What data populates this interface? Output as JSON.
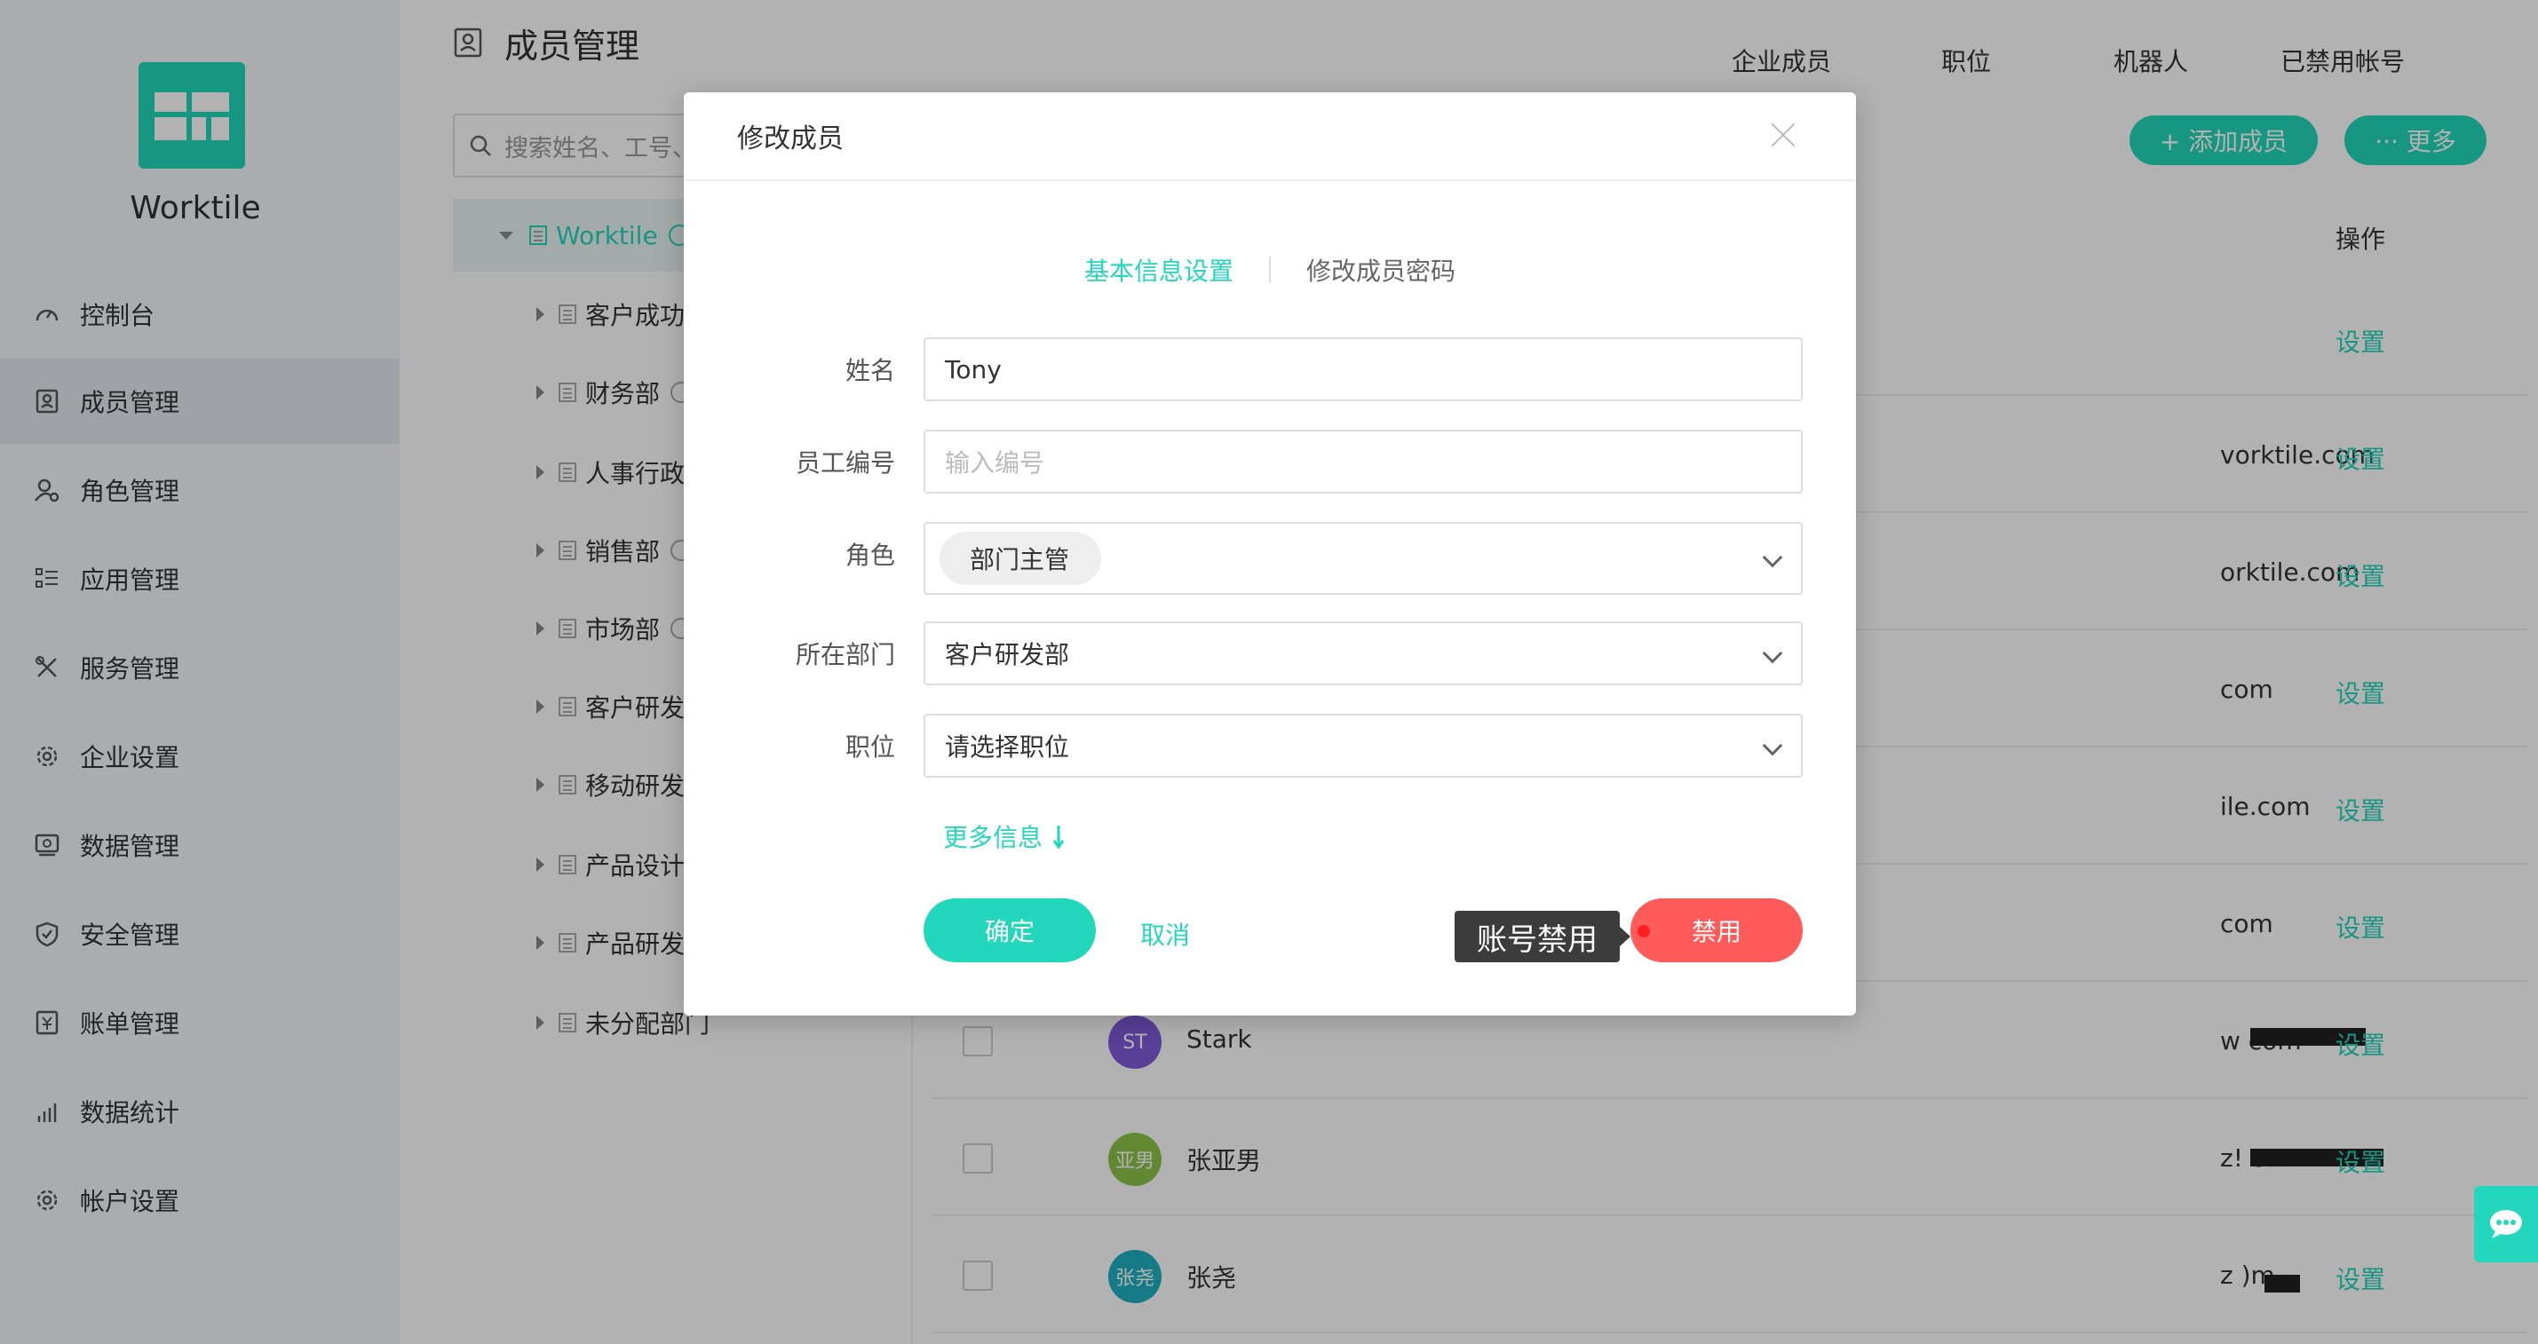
{
  "app": {
    "name": "Worktile",
    "brand_color": "#22d7bb"
  },
  "sidebar": {
    "items": [
      {
        "label": "控制台",
        "icon": "dashboard-icon"
      },
      {
        "label": "成员管理",
        "icon": "members-icon",
        "active": true
      },
      {
        "label": "角色管理",
        "icon": "roles-icon"
      },
      {
        "label": "应用管理",
        "icon": "apps-icon"
      },
      {
        "label": "服务管理",
        "icon": "tools-icon"
      },
      {
        "label": "企业设置",
        "icon": "gear-icon"
      },
      {
        "label": "数据管理",
        "icon": "data-icon"
      },
      {
        "label": "安全管理",
        "icon": "shield-icon"
      },
      {
        "label": "账单管理",
        "icon": "bill-icon"
      },
      {
        "label": "数据统计",
        "icon": "chart-icon"
      },
      {
        "label": "帐户设置",
        "icon": "settings-icon"
      }
    ]
  },
  "header": {
    "title": "成员管理",
    "tabs": [
      "企业成员",
      "职位",
      "机器人",
      "已禁用帐号"
    ]
  },
  "search": {
    "placeholder": "搜索姓名、工号、"
  },
  "toolbar": {
    "add_label": "+ 添加成员",
    "more_label": "··· 更多"
  },
  "tree": {
    "root": "Worktile",
    "children": [
      "客户成功",
      "财务部",
      "人事行政",
      "销售部",
      "市场部",
      "客户研发",
      "移动研发",
      "产品设计",
      "产品研发",
      "未分配部门"
    ]
  },
  "table": {
    "op_header": "操作",
    "rows": [
      {
        "email": "",
        "action": "设置"
      },
      {
        "email": "vorktile.com",
        "action": "设置"
      },
      {
        "email": "orktile.com",
        "action": "设置"
      },
      {
        "email": "com",
        "action": "设置"
      },
      {
        "email": "ile.com",
        "action": "设置"
      },
      {
        "email": "com",
        "action": "设置"
      },
      {
        "initials": "ST",
        "name": "Stark",
        "avatar_color": "#7e5bd8",
        "email": "w               com",
        "action": "设置"
      },
      {
        "initials": "亚男",
        "name": "张亚男",
        "avatar_color": "#8bc34a",
        "email": "z!                om",
        "action": "设置"
      },
      {
        "initials": "张尧",
        "name": "张尧",
        "avatar_color": "#1fb0c0",
        "email": "z                  )m",
        "action": "设置"
      }
    ]
  },
  "modal": {
    "title": "修改成员",
    "tabs": [
      "基本信息设置",
      "修改成员密码"
    ],
    "active_tab": 0,
    "fields": {
      "name": {
        "label": "姓名",
        "value": "Tony"
      },
      "employee_id": {
        "label": "员工编号",
        "placeholder": "输入编号"
      },
      "role": {
        "label": "角色",
        "value": "部门主管"
      },
      "department": {
        "label": "所在部门",
        "value": "客户研发部"
      },
      "position": {
        "label": "职位",
        "value": "请选择职位"
      }
    },
    "more_info": "更多信息",
    "confirm": "确定",
    "cancel": "取消",
    "disable": "禁用",
    "tooltip": "账号禁用"
  }
}
